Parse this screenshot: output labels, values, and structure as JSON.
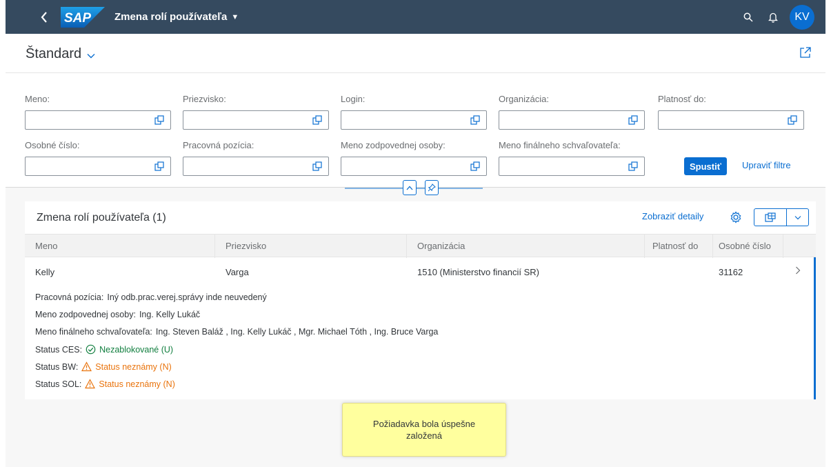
{
  "shell": {
    "back_icon": "back-arrow-icon",
    "logo_text": "SAP",
    "app_title": "Zmena rolí používateľa",
    "avatar_initials": "KV",
    "colors": {
      "shellbar": "#354a5f",
      "accent": "#0a6ed1",
      "success": "#107e3e",
      "warning": "#e9730c"
    }
  },
  "header": {
    "variant": "Štandard"
  },
  "filters": {
    "row1": [
      {
        "label": "Meno:"
      },
      {
        "label": "Priezvisko:"
      },
      {
        "label": "Login:"
      },
      {
        "label": "Organizácia:"
      },
      {
        "label": "Platnosť do:"
      }
    ],
    "row2": [
      {
        "label": "Osobné číslo:"
      },
      {
        "label": "Pracovná pozícia:"
      },
      {
        "label": "Meno zodpovednej osoby:"
      },
      {
        "label": "Meno finálneho schvaľovateľa:"
      }
    ],
    "go_label": "Spustiť",
    "adapt_label": "Upraviť filtre"
  },
  "table": {
    "title": "Zmena rolí používateľa (1)",
    "show_details": "Zobraziť detaily",
    "columns": [
      "Meno",
      "Priezvisko",
      "Organizácia",
      "Platnosť do",
      "Osobné číslo"
    ],
    "row": {
      "meno": "Kelly",
      "priezvisko": "Varga",
      "organizacia": "1510 (Ministerstvo financií SR)",
      "platnost": "",
      "osobne_cislo": "31162",
      "details": {
        "pozicia_label": "Pracovná pozícia:",
        "pozicia_value": "Iný odb.prac.verej.správy inde neuvedený",
        "zodpovedna_label": "Meno zodpovednej osoby:",
        "zodpovedna_value": "Ing. Kelly Lukáč",
        "schvalovatel_label": "Meno finálneho schvaľovateľa:",
        "schvalovatel_value": "Ing. Steven Baláž , Ing. Kelly Lukáč , Mgr. Michael Tóth , Ing. Bruce Varga",
        "ces_label": "Status CES:",
        "ces_value": "Nezablokované (U)",
        "bw_label": "Status BW:",
        "bw_value": "Status neznámy (N)",
        "sol_label": "Status SOL:",
        "sol_value": "Status neznámy (N)"
      }
    }
  },
  "toast": {
    "message": "Požiadavka bola úspešne založená"
  }
}
